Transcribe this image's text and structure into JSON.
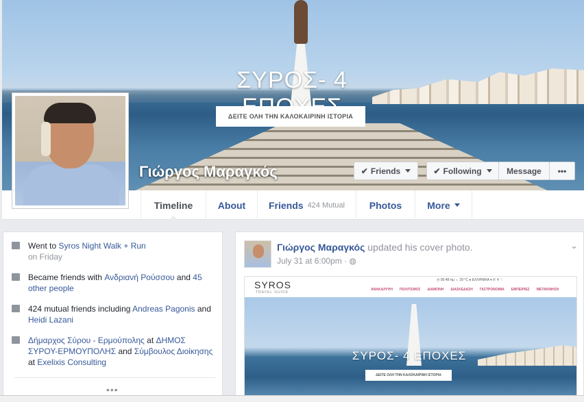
{
  "cover": {
    "title": "ΣΥΡΟΣ- 4 ΕΠΟΧΕΣ",
    "cta": "ΔΕΙΤΕ ΟΛΗ ΤΗΝ ΚΑΛΟΚΑΙΡΙΝΗ ΙΣΤΟΡΙΑ"
  },
  "profile": {
    "name": "Γιώργος Μαραγκός"
  },
  "actions": {
    "friends": "Friends",
    "following": "Following",
    "message": "Message",
    "more": "•••"
  },
  "nav": {
    "timeline": "Timeline",
    "about": "About",
    "friends": "Friends",
    "friends_count": "424 Mutual",
    "photos": "Photos",
    "more": "More"
  },
  "intro": {
    "r1_a": "Went to ",
    "r1_link": "Syros Night Walk + Run",
    "r1_sub": "on Friday",
    "r2_a": "Became friends with ",
    "r2_link": "Ανδριανή Ρούσσου",
    "r2_b": " and ",
    "r2_link2": "45 other people",
    "r3_a": "424 mutual friends including ",
    "r3_link": "Andreas Pagonis",
    "r3_b": " and ",
    "r3_link2": "Heidi Lazani",
    "r4_link": "Δήμαρχος Σύρου - Ερμούπολης",
    "r4_a": " at ",
    "r4_link2": "ΔΗΜΟΣ ΣΥΡΟΥ-ΕΡΜΟΥΠΟΛΗΣ",
    "r4_b": " and ",
    "r4_link3": "Σύμβουλος Διοίκησης",
    "r4_c": " at ",
    "r4_link4": "Exelixis Consulting",
    "more": "•••"
  },
  "post": {
    "author": "Γιώργος Μαραγκός",
    "action": " updated his cover photo.",
    "time": "July 31 at 6:00pm",
    "privacy_glyph": "· ◍",
    "chevron": "⌄"
  },
  "shot": {
    "logo": "SYROS",
    "logo_sub": "TRAVEL GUIDE",
    "menu": [
      "ΑΝΑΚΑΛΥΨΗ",
      "ΠΟΛΙΤΙΣΜΟΣ",
      "ΔΙΑΜΟΝΗ",
      "ΔΙΑΣΚΕΔΑΣΗ",
      "ΓΑΣΤΡΟΝΟΜΙΑ",
      "ΕΜΠΕΙΡΙΕΣ",
      "ΜΕΤΑΚΙΝΗΣΗ"
    ],
    "tools": "◷ 05:48 πμ   ☼ 29 °C   ● ΕΛΛΗΝΙΚΑ ▾        ✆  ⚲  ♡",
    "title": "ΣΥΡΟΣ- 4 ΕΠΟΧΕΣ",
    "cta": "ΔΕΙΤΕ ΟΛΗ ΤΗΝ ΚΑΛΟΚΑΙΡΙΝΗ ΙΣΤΟΡΙΑ"
  }
}
